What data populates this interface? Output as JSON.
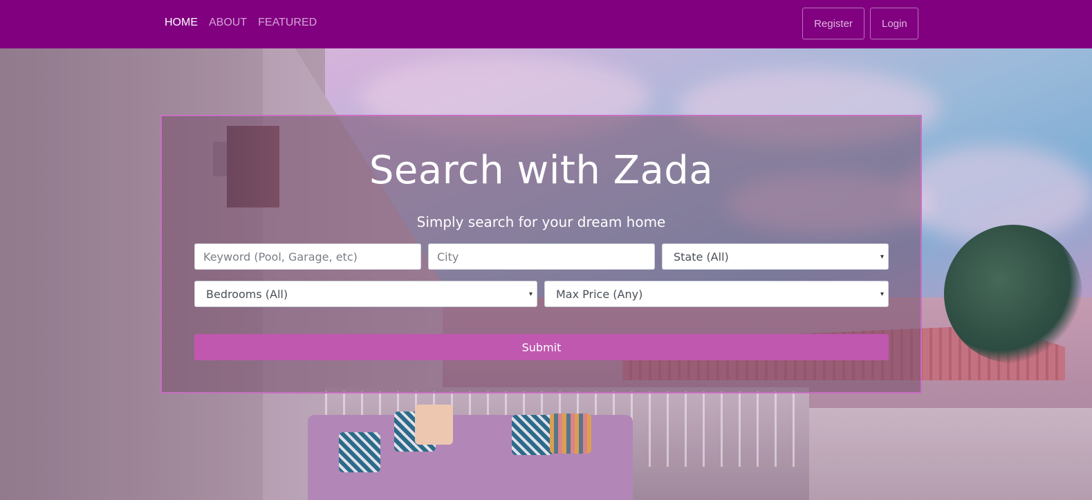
{
  "nav": {
    "links": [
      {
        "label": "HOME"
      },
      {
        "label": "ABOUT"
      },
      {
        "label": "FEATURED"
      }
    ],
    "register_label": "Register",
    "login_label": "Login"
  },
  "hero": {
    "title": "Search with Zada",
    "subtitle": "Simply search for your dream home"
  },
  "search": {
    "keyword_placeholder": "Keyword (Pool, Garage, etc)",
    "city_placeholder": "City",
    "state_selected": "State (All)",
    "bedrooms_selected": "Bedrooms (All)",
    "max_price_selected": "Max Price (Any)",
    "caret_glyph": "▾",
    "submit_label": "Submit"
  },
  "colors": {
    "navbar": "#800080",
    "accent": "#c058b0",
    "panel_border": "#c86fc4"
  }
}
